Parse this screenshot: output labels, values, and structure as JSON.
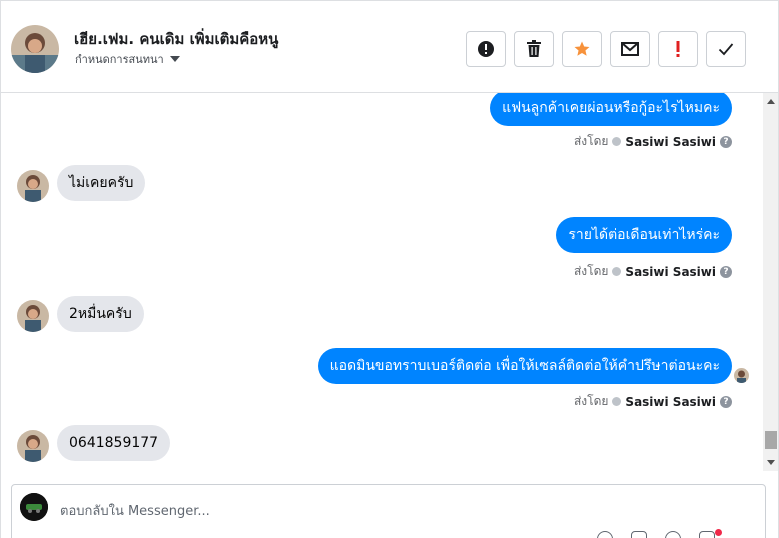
{
  "header": {
    "contact_name": "เฮีย.เฟม. คนเดิม เพิ่มเติมคือหนู",
    "subtitle": "กำหนดการสนทนา",
    "actions": [
      {
        "name": "spam-button",
        "icon": "alert-circle-icon"
      },
      {
        "name": "delete-button",
        "icon": "trash-icon"
      },
      {
        "name": "star-button",
        "icon": "star-icon",
        "color": "#f7923b"
      },
      {
        "name": "unread-button",
        "icon": "envelope-icon"
      },
      {
        "name": "important-button",
        "icon": "exclamation-icon",
        "color": "#e02020"
      },
      {
        "name": "done-button",
        "icon": "check-icon"
      }
    ]
  },
  "messages": [
    {
      "direction": "out",
      "text": "แฟนลูกค้าเคยผ่อนหรือกู้อะไรไหมคะ",
      "sent_by_prefix": "ส่งโดย",
      "sent_by": "Sasiwi Sasiwi"
    },
    {
      "direction": "in",
      "text": "ไม่เคยครับ"
    },
    {
      "direction": "out",
      "text": "รายได้ต่อเดือนเท่าไหร่คะ",
      "sent_by_prefix": "ส่งโดย",
      "sent_by": "Sasiwi Sasiwi"
    },
    {
      "direction": "in",
      "text": "2หมื่นครับ"
    },
    {
      "direction": "out",
      "text": "แอดมินขอทราบเบอร์ติดต่อ เพื่อให้เซลล์ติดต่อให้คำปรึษาต่อนะคะ",
      "sent_by_prefix": "ส่งโดย",
      "sent_by": "Sasiwi Sasiwi"
    },
    {
      "direction": "in",
      "text": "0641859177"
    }
  ],
  "composer": {
    "placeholder": "ตอบกลับใน Messenger..."
  },
  "colors": {
    "outgoing_bubble": "#0084ff",
    "incoming_bubble": "#e4e6eb"
  }
}
